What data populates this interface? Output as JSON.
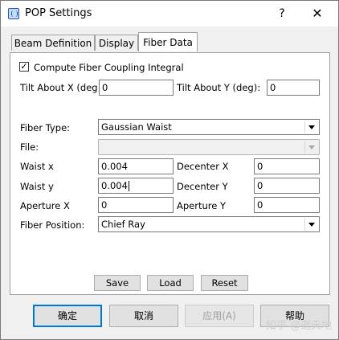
{
  "window": {
    "title": "POP Settings",
    "help": "?",
    "close": "✕"
  },
  "tabs": [
    {
      "label": "Beam Definition"
    },
    {
      "label": "Display"
    },
    {
      "label": "Fiber Data"
    }
  ],
  "form": {
    "compute_label": "Compute Fiber Coupling Integral",
    "compute_checked": "✓",
    "tilt_x_label": "Tilt About X (deg):",
    "tilt_x_value": "0",
    "tilt_y_label": "Tilt About Y (deg):",
    "tilt_y_value": "0",
    "fiber_type_label": "Fiber Type:",
    "fiber_type_value": "Gaussian Waist",
    "file_label": "File:",
    "file_value": "",
    "waist_x_label": "Waist x",
    "waist_x_value": "0.004",
    "decenter_x_label": "Decenter X",
    "decenter_x_value": "0",
    "waist_y_label": "Waist y",
    "waist_y_value": "0.004",
    "decenter_y_label": "Decenter Y",
    "decenter_y_value": "0",
    "aperture_x_label": "Aperture X",
    "aperture_x_value": "0",
    "aperture_y_label": "Aperture Y",
    "aperture_y_value": "0",
    "fiber_position_label": "Fiber Position:",
    "fiber_position_value": "Chief Ray"
  },
  "panel_buttons": {
    "save": "Save",
    "load": "Load",
    "reset": "Reset"
  },
  "dialog_buttons": {
    "ok": "确定",
    "cancel": "取消",
    "apply": "应用(A)",
    "help": "帮助"
  },
  "watermark": "知乎 @逝天地"
}
